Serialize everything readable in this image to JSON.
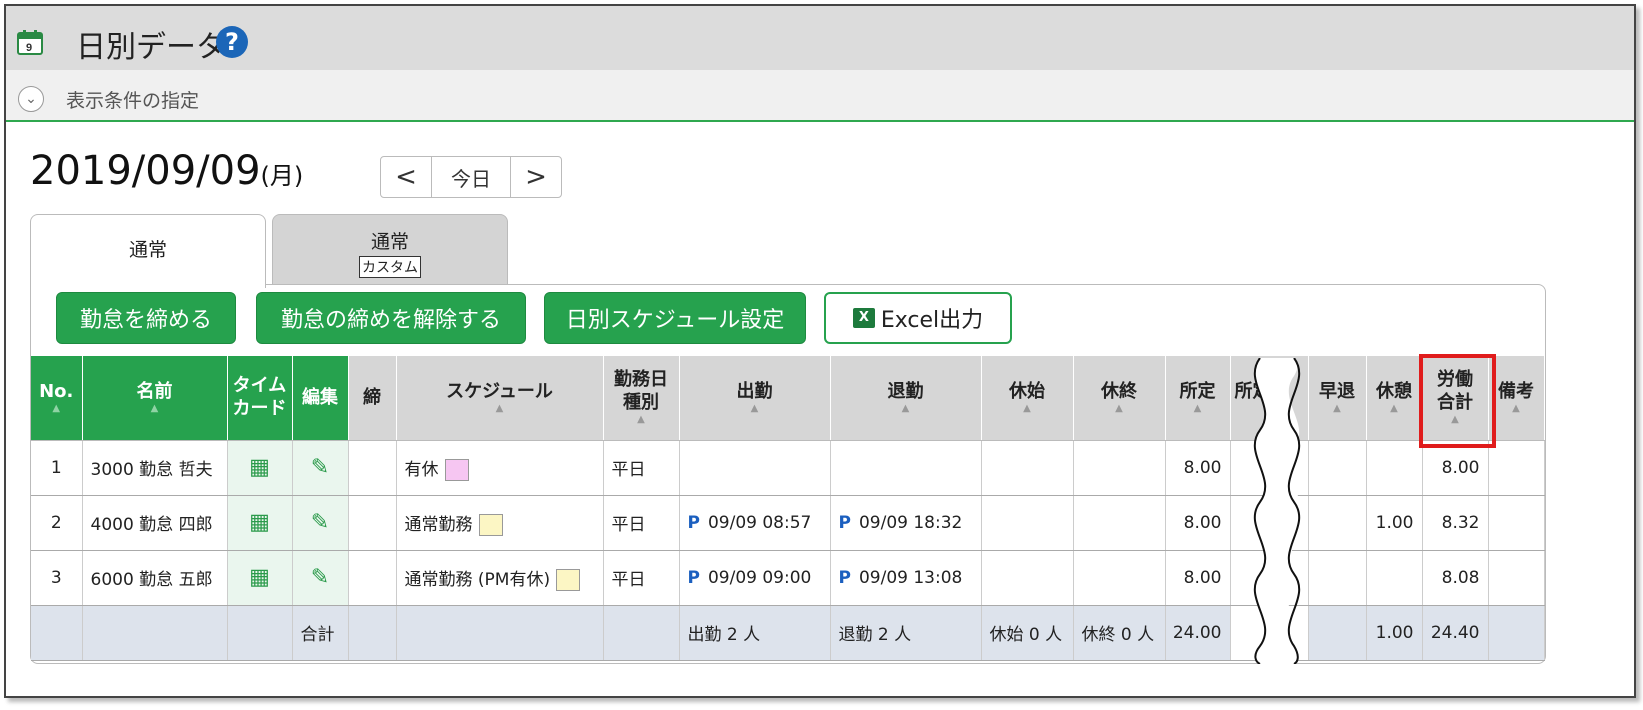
{
  "header": {
    "title": "日別データ",
    "help": "?"
  },
  "conditions": {
    "label": "表示条件の指定",
    "toggle": "⌄"
  },
  "date": {
    "value": "2019/09/09",
    "dow": "(月)"
  },
  "nav": {
    "prev": "<",
    "today": "今日",
    "next": ">"
  },
  "tabs": {
    "tab1": "通常",
    "tab2_main": "通常",
    "tab2_sub": "カスタム"
  },
  "buttons": {
    "close": "勤怠を締める",
    "unclose": "勤怠の締めを解除する",
    "schedule": "日別スケジュール設定",
    "excel": "Excel出力"
  },
  "table": {
    "headers": {
      "no": "No.",
      "name": "名前",
      "timecard_1": "タイム",
      "timecard_2": "カード",
      "edit": "編集",
      "shime": "締",
      "schedule": "スケジュール",
      "daytype_1": "勤務日",
      "daytype_2": "種別",
      "in": "出勤",
      "out": "退勤",
      "break_start": "休始",
      "break_end": "休終",
      "scheduled": "所定",
      "overtime_partial": "所定",
      "early": "早退",
      "rest": "休憩",
      "labor_1": "労働",
      "labor_2": "合計",
      "note": "備考"
    },
    "rows": [
      {
        "no": "1",
        "name": "3000 勤怠 哲夫",
        "schedule": "有休",
        "swatch": "#f6c6f2",
        "daytype": "平日",
        "in_p": "",
        "in": "",
        "out_p": "",
        "out": "",
        "scheduled": "8.00",
        "rest": "",
        "labor": "8.00"
      },
      {
        "no": "2",
        "name": "4000 勤怠 四郎",
        "schedule": "通常勤務",
        "swatch": "#fcf6c4",
        "daytype": "平日",
        "in_p": "P",
        "in": "09/09 08:57",
        "out_p": "P",
        "out": "09/09 18:32",
        "scheduled": "8.00",
        "rest": "1.00",
        "labor": "8.32"
      },
      {
        "no": "3",
        "name": "6000 勤怠 五郎",
        "schedule": "通常勤務 (PM有休)",
        "swatch": "#fcf6c4",
        "daytype": "平日",
        "in_p": "P",
        "in": "09/09 09:00",
        "out_p": "P",
        "out": "09/09 13:08",
        "scheduled": "8.00",
        "rest": "",
        "labor": "8.08"
      }
    ],
    "total": {
      "label": "合計",
      "in": "出勤 2 人",
      "out": "退勤 2 人",
      "break_start": "休始 0 人",
      "break_end": "休終 0 人",
      "scheduled": "24.00",
      "rest": "1.00",
      "labor": "24.40"
    }
  },
  "colors": {
    "accent_green": "#26a24e",
    "highlight_red": "#e01c1c",
    "help_blue": "#1b66b8"
  }
}
